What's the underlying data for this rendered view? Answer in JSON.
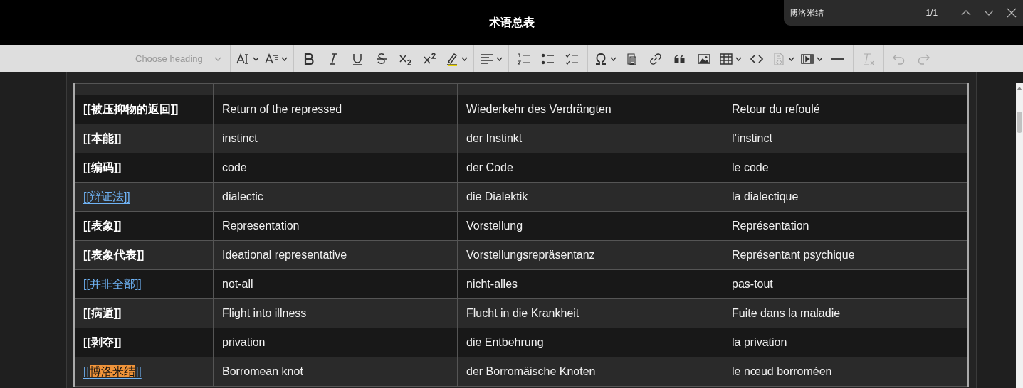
{
  "window": {
    "title": "术语总表"
  },
  "find_bar": {
    "value": "博洛米结",
    "count": "1/1"
  },
  "toolbar": {
    "heading": {
      "placeholder": "Choose heading"
    },
    "tools": [
      {
        "kind": "font-size",
        "dropdown": true,
        "disabled": false
      },
      {
        "kind": "font-family",
        "dropdown": true,
        "disabled": false
      },
      {
        "kind": "divider"
      },
      {
        "kind": "bold",
        "dropdown": false,
        "disabled": false
      },
      {
        "kind": "italic",
        "dropdown": false,
        "disabled": false
      },
      {
        "kind": "underline",
        "dropdown": false,
        "disabled": false
      },
      {
        "kind": "strike",
        "dropdown": false,
        "disabled": false
      },
      {
        "kind": "subscript",
        "dropdown": false,
        "disabled": false
      },
      {
        "kind": "superscript",
        "dropdown": false,
        "disabled": false
      },
      {
        "kind": "highlight",
        "dropdown": true,
        "disabled": false
      },
      {
        "kind": "divider"
      },
      {
        "kind": "align",
        "dropdown": true,
        "disabled": false
      },
      {
        "kind": "divider"
      },
      {
        "kind": "numbered-list",
        "dropdown": false,
        "disabled": false
      },
      {
        "kind": "bullet-list",
        "dropdown": false,
        "disabled": false
      },
      {
        "kind": "todo-list",
        "dropdown": false,
        "disabled": false
      },
      {
        "kind": "divider"
      },
      {
        "kind": "special-char",
        "dropdown": true,
        "disabled": false
      },
      {
        "kind": "paste-text",
        "dropdown": false,
        "disabled": false
      },
      {
        "kind": "link",
        "dropdown": false,
        "disabled": false
      },
      {
        "kind": "quote",
        "dropdown": false,
        "disabled": false
      },
      {
        "kind": "image",
        "dropdown": false,
        "disabled": false
      },
      {
        "kind": "table",
        "dropdown": true,
        "disabled": false
      },
      {
        "kind": "code",
        "dropdown": false,
        "disabled": false
      },
      {
        "kind": "source",
        "dropdown": true,
        "disabled": true
      },
      {
        "kind": "media",
        "dropdown": true,
        "disabled": false
      },
      {
        "kind": "rule",
        "dropdown": false,
        "disabled": false
      },
      {
        "kind": "divider"
      },
      {
        "kind": "clear-format",
        "dropdown": false,
        "disabled": true
      },
      {
        "kind": "divider"
      },
      {
        "kind": "undo",
        "dropdown": false,
        "disabled": true
      },
      {
        "kind": "redo",
        "dropdown": false,
        "disabled": true
      }
    ]
  },
  "table": {
    "rows": [
      {
        "term": {
          "link": false,
          "parts": [
            {
              "text": "[[被压抑物的返回]]",
              "hit": false
            }
          ]
        },
        "cells": [
          "Return of the repressed",
          "Wiederkehr des Verdrängten",
          "Retour du refoulé"
        ]
      },
      {
        "term": {
          "link": false,
          "parts": [
            {
              "text": "[[本能]]",
              "hit": false
            }
          ]
        },
        "cells": [
          "instinct",
          "der Instinkt",
          "l’instinct"
        ]
      },
      {
        "term": {
          "link": false,
          "parts": [
            {
              "text": "[[编码]]",
              "hit": false
            }
          ]
        },
        "cells": [
          "code",
          "der Code",
          "le code"
        ]
      },
      {
        "term": {
          "link": true,
          "parts": [
            {
              "text": "[[辩证法]]",
              "hit": false
            }
          ]
        },
        "cells": [
          "dialectic",
          "die Dialektik",
          "la dialectique"
        ]
      },
      {
        "term": {
          "link": false,
          "parts": [
            {
              "text": "[[表象]]",
              "hit": false
            }
          ]
        },
        "cells": [
          "Representation",
          "Vorstellung",
          "Représentation"
        ]
      },
      {
        "term": {
          "link": false,
          "parts": [
            {
              "text": "[[表象代表]]",
              "hit": false
            }
          ]
        },
        "cells": [
          "Ideational representative",
          "Vorstellungsrepräsentanz",
          "Représentant psychique"
        ]
      },
      {
        "term": {
          "link": true,
          "parts": [
            {
              "text": "[[并非全部]]",
              "hit": false
            }
          ]
        },
        "cells": [
          "not-all",
          "nicht-alles",
          "pas-tout"
        ]
      },
      {
        "term": {
          "link": false,
          "parts": [
            {
              "text": "[[病遁]]",
              "hit": false
            }
          ]
        },
        "cells": [
          "Flight into illness",
          "Flucht in die Krankheit",
          "Fuite dans la maladie"
        ]
      },
      {
        "term": {
          "link": false,
          "parts": [
            {
              "text": "[[剥夺]]",
              "hit": false
            }
          ]
        },
        "cells": [
          "privation",
          "die Entbehrung",
          "la privation"
        ]
      },
      {
        "term": {
          "link": true,
          "parts": [
            {
              "text": "[[",
              "hit": false
            },
            {
              "text": "博洛米结",
              "hit": true
            },
            {
              "text": "]]",
              "hit": false
            }
          ]
        },
        "cells": [
          "Borromean knot",
          "der Borromäische Knoten",
          "le nœud borroméen"
        ]
      }
    ]
  }
}
